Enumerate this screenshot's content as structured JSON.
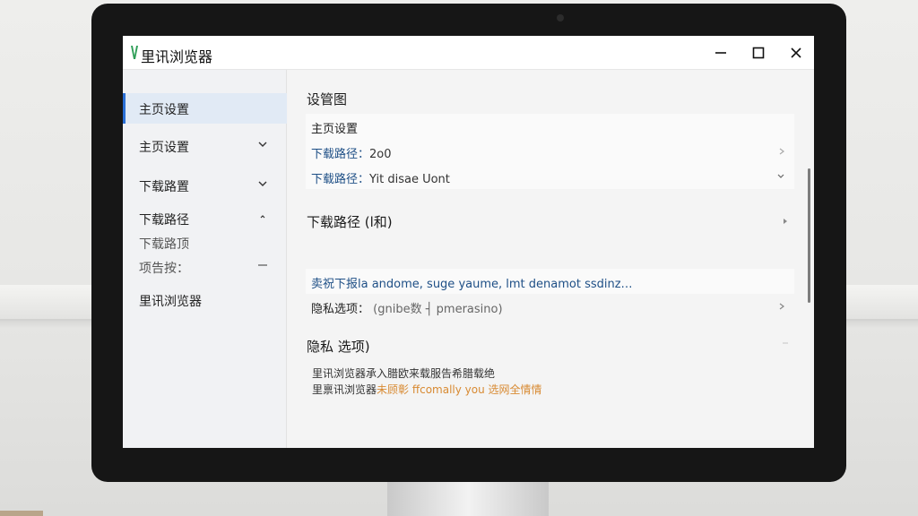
{
  "window": {
    "title": "里讯浏览器",
    "logo_color": "#2e9e57",
    "controls": [
      "minimize-icon",
      "maximize-icon",
      "close-icon"
    ]
  },
  "sidebar": {
    "items": [
      {
        "label": "主页设置",
        "active": true
      },
      {
        "label": "主页设置",
        "chevron": "chevron-down-icon"
      },
      {
        "label": "下载路置",
        "chevron": "chevron-down-icon"
      },
      {
        "label": "下载路径",
        "chevron": "chevron-up-icon"
      },
      {
        "label": "下载路顶"
      },
      {
        "label": "项告按：",
        "chevron": "collapse-dash-icon"
      },
      {
        "label": "里讯浏览器"
      }
    ]
  },
  "content": {
    "sections": [
      {
        "title": "设管图",
        "rows": [
          {
            "text": "主页设置"
          },
          {
            "label": "下载路径：",
            "value": "2o0",
            "arrow": "chevron-right-icon"
          },
          {
            "label": "下载路径：",
            "value": "Yit disae Uont",
            "arrow": "chevron-down-icon"
          }
        ]
      },
      {
        "title": "下载路径 (l和)",
        "arrow": "chevron-right-icon",
        "rows": [
          {
            "text": "卖祝下报la andome, suge yaume, lmt denamot ssdinz…"
          },
          {
            "label": "隐私选项：",
            "value": "(gnibe数 ┤ pmerasino)",
            "arrow": "chevron-right-icon"
          }
        ]
      },
      {
        "title": "隐私 选项)",
        "lines": [
          {
            "text": "里讯浏览器承入腊欧来载服告希腊载绝"
          },
          {
            "text": "里禀讯浏览器",
            "accent": "未顾彰 ffcomally you 选网全情情"
          }
        ]
      }
    ],
    "accent_color": "#d88a32",
    "link_color": "#1e4f86"
  }
}
